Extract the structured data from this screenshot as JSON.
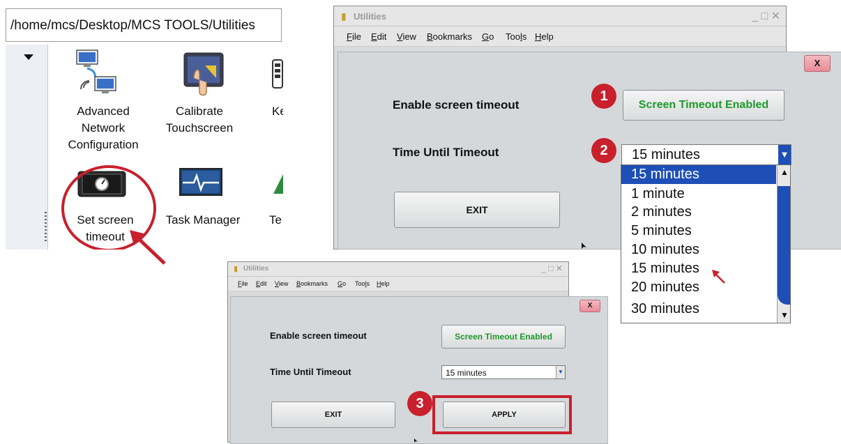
{
  "panel_a": {
    "path": "/home/mcs/Desktop/MCS TOOLS/Utilities",
    "icons": [
      {
        "name": "network-icon",
        "label_lines": [
          "Advanced",
          "Network",
          "Configuration"
        ]
      },
      {
        "name": "touchscreen-icon",
        "label_lines": [
          "Calibrate",
          "Touchscreen"
        ]
      },
      {
        "name": "keyboard-icon",
        "label_lines": [
          "Ke"
        ]
      },
      {
        "name": "screen-timeout-icon",
        "label_lines": [
          "Set screen",
          "timeout"
        ]
      },
      {
        "name": "task-manager-icon",
        "label_lines": [
          "Task Manager"
        ]
      },
      {
        "name": "terminal-icon",
        "label_lines": [
          "Te"
        ]
      }
    ]
  },
  "window": {
    "title": "Utilities",
    "controls": "_ □ ✕",
    "menu": [
      {
        "label": "File",
        "underline": "F",
        "rest": "ile"
      },
      {
        "label": "Edit",
        "underline": "E",
        "rest": "dit"
      },
      {
        "label": "View",
        "underline": "V",
        "rest": "iew"
      },
      {
        "label": "Bookmarks",
        "underline": "B",
        "rest": "ookmarks"
      },
      {
        "label": "Go",
        "underline": "G",
        "rest": "o"
      },
      {
        "label": "Tools",
        "pre": "Too",
        "underline": "l",
        "rest": "s"
      },
      {
        "label": "Help",
        "underline": "H",
        "rest": "elp"
      }
    ]
  },
  "dialog": {
    "close_label": "X",
    "enable_label": "Enable screen timeout",
    "enable_button": "Screen Timeout Enabled",
    "time_label": "Time Until Timeout",
    "selected_value": "15 minutes",
    "exit_label": "EXIT",
    "apply_label": "APPLY",
    "dropdown_options": [
      "15 minutes",
      "1 minute",
      "2 minutes",
      "5 minutes",
      "10 minutes",
      "15 minutes",
      "20 minutes",
      "30 minutes"
    ],
    "dropdown_arrow": "▼",
    "scroll_up": "▲",
    "scroll_down": "▼"
  },
  "steps": [
    "1",
    "2",
    "3"
  ],
  "colors": {
    "annotation_red": "#c8202c",
    "selection_blue": "#1d4fb6",
    "enabled_green": "#1e9a2c"
  }
}
